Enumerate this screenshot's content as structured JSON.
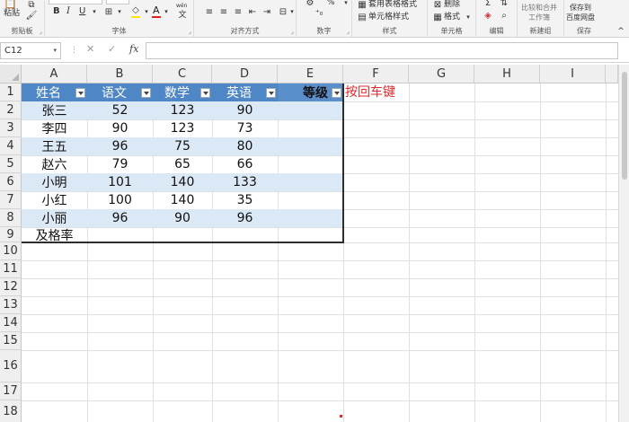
{
  "ribbon": {
    "paste_label": "粘贴",
    "groups": {
      "clipboard": "剪贴板",
      "font": "字体",
      "alignment": "对齐方式",
      "number": "数字",
      "styles": "样式",
      "cells": "单元格",
      "editing": "编辑",
      "new_group": "新建组",
      "save": "保存"
    },
    "percent_symbol": "%",
    "table_format": "套用表格格式",
    "cell_style": "单元格样式",
    "delete": "删除",
    "format": "格式",
    "compare_merge_line1": "比较和合并",
    "compare_merge_line2": "工作簿",
    "save_to_line1": "保存到",
    "save_to_line2": "百度网盘",
    "bold": "B",
    "italic": "I",
    "underline": "U",
    "font_color_letter": "A",
    "wen_icon": "wén"
  },
  "formula_bar": {
    "name_box": "C12",
    "cancel_symbol": "✕",
    "enter_symbol": "✓",
    "fx_symbol": "fx",
    "formula": ""
  },
  "grid": {
    "column_headers": [
      "A",
      "B",
      "C",
      "D",
      "E",
      "F",
      "G",
      "H",
      "I"
    ],
    "row_headers": [
      "1",
      "2",
      "3",
      "4",
      "5",
      "6",
      "7",
      "8",
      "9",
      "10",
      "11",
      "12",
      "13",
      "14",
      "15",
      "16",
      "17",
      "18"
    ],
    "table_headers": [
      "姓名",
      "语文",
      "数学",
      "英语",
      "等级"
    ],
    "rows": [
      [
        "张三",
        "52",
        "123",
        "90"
      ],
      [
        "李四",
        "90",
        "123",
        "73"
      ],
      [
        "王五",
        "96",
        "75",
        "80"
      ],
      [
        "赵六",
        "79",
        "65",
        "66"
      ],
      [
        "小明",
        "101",
        "140",
        "133"
      ],
      [
        "小红",
        "100",
        "140",
        "35"
      ],
      [
        "小丽",
        "96",
        "90",
        "96"
      ]
    ],
    "row9_label": "及格率",
    "note": "按回车键"
  },
  "colors": {
    "table_header": "#4f86c6",
    "band": "#dbe8f6",
    "note": "#e0282c"
  }
}
